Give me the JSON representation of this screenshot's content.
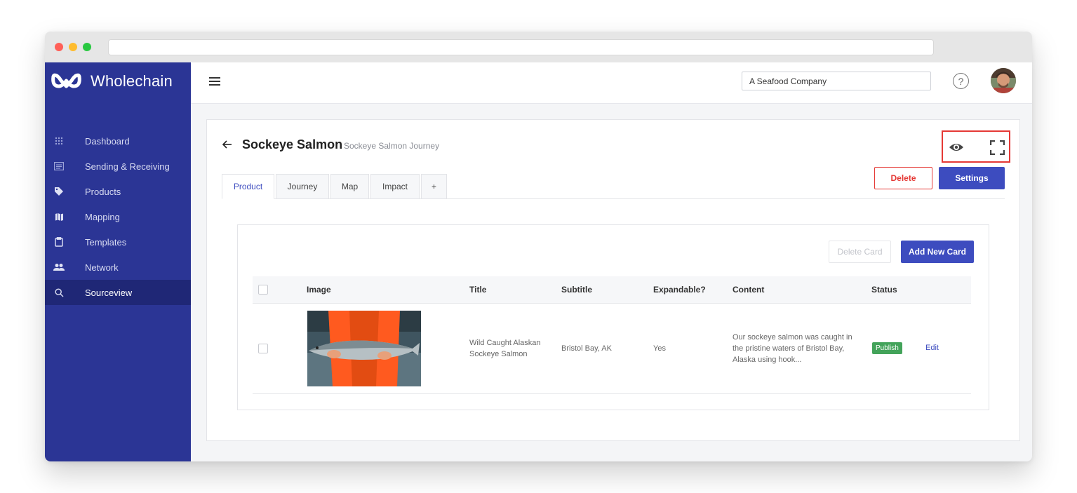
{
  "brand": {
    "name": "Wholechain"
  },
  "sidebar": {
    "items": [
      {
        "label": "Dashboard",
        "icon": "grid-icon",
        "active": false
      },
      {
        "label": "Sending & Receiving",
        "icon": "list-icon",
        "active": false
      },
      {
        "label": "Products",
        "icon": "tag-icon",
        "active": false
      },
      {
        "label": "Mapping",
        "icon": "map-icon",
        "active": false
      },
      {
        "label": "Templates",
        "icon": "clipboard-icon",
        "active": false
      },
      {
        "label": "Network",
        "icon": "people-icon",
        "active": false
      },
      {
        "label": "Sourceview",
        "icon": "search-icon",
        "active": true
      }
    ]
  },
  "topbar": {
    "company": "A Seafood Company",
    "help": "?"
  },
  "page": {
    "title": "Sockeye Salmon",
    "subtitle": "Sockeye Salmon Journey",
    "delete_label": "Delete",
    "settings_label": "Settings",
    "tabs": [
      {
        "label": "Product",
        "active": true
      },
      {
        "label": "Journey",
        "active": false
      },
      {
        "label": "Map",
        "active": false
      },
      {
        "label": "Impact",
        "active": false
      },
      {
        "label": "+",
        "active": false
      }
    ]
  },
  "cards": {
    "delete_label": "Delete Card",
    "add_label": "Add New Card",
    "columns": [
      "Image",
      "Title",
      "Subtitle",
      "Expandable?",
      "Content",
      "Status"
    ],
    "rows": [
      {
        "title": "Wild Caught Alaskan Sockeye Salmon",
        "subtitle": "Bristol Bay, AK",
        "expandable": "Yes",
        "content": "Our sockeye salmon was caught in the pristine waters of Bristol Bay, Alaska using hook...",
        "status": "Publish",
        "edit_label": "Edit"
      }
    ]
  },
  "colors": {
    "sidebar": "#2b3595",
    "accent": "#3d4cbf",
    "danger": "#e53935",
    "publish": "#43a35a"
  }
}
